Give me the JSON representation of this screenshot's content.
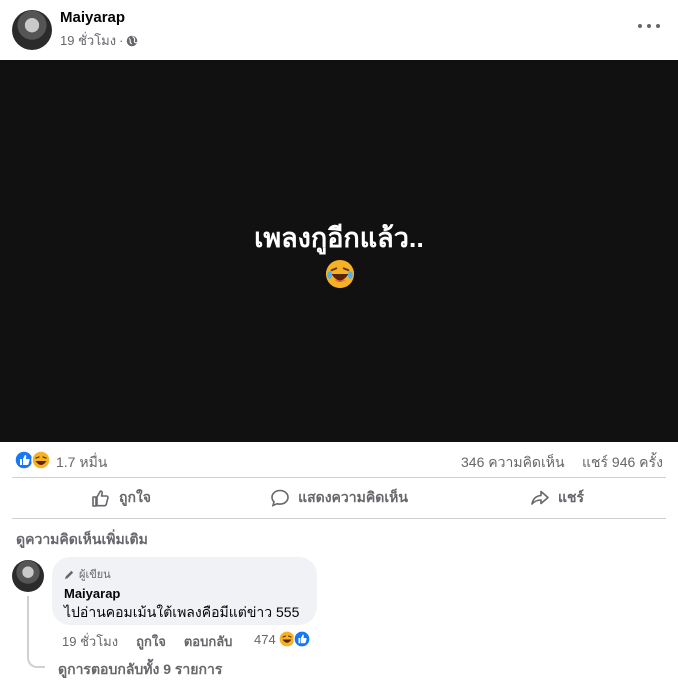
{
  "post": {
    "author": "Maiyarap",
    "time": "19 ชั่วโมง",
    "meta_separator": "·",
    "privacy_icon": "globe-icon",
    "menu_icon": "more-icon"
  },
  "media": {
    "text": "เพลงกูอีกแล้ว..",
    "emoji": "laughing-tears-emoji",
    "background": "#111111"
  },
  "stats": {
    "reactions": "1.7 หมื่น",
    "comments": "346 ความคิดเห็น",
    "shares": "แชร์ 946 ครั้ง",
    "reaction_icons": [
      "like-icon",
      "haha-icon"
    ]
  },
  "actions": {
    "like": "ถูกใจ",
    "comment": "แสดงความคิดเห็น",
    "share": "แชร์"
  },
  "comments": {
    "view_more": "ดูความคิดเห็นเพิ่มเติม",
    "items": [
      {
        "badge": "ผู้เขียน",
        "author": "Maiyarap",
        "text": "ไปอ่านคอมเม้นใต้เพลงคือมีแต่ข่าว 555",
        "time": "19 ชั่วโมง",
        "like": "ถูกใจ",
        "reply": "ตอบกลับ",
        "reaction_count": "474",
        "view_replies": "ดูการตอบกลับทั้ง 9 รายการ"
      }
    ]
  },
  "colors": {
    "like_blue": "#1877f2",
    "haha_yellow": "#f7b125",
    "secondary_text": "#65676b",
    "bubble_bg": "#f0f2f5"
  }
}
